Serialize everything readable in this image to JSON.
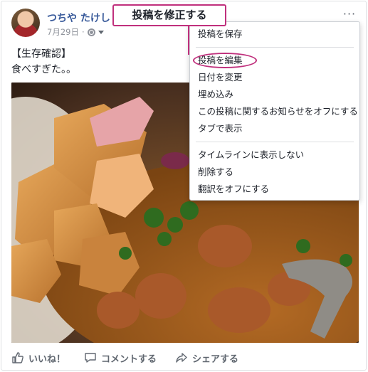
{
  "post": {
    "author": "つちや たけし",
    "date": "7月29日",
    "separator": "·",
    "text_line1": "【生存確認】",
    "text_line2": "食べすぎた。。",
    "photo_alt": "food-photo"
  },
  "actions": {
    "like_label": "いいね！",
    "comment_label": "コメントする",
    "share_label": "シェアする"
  },
  "more_icon": "···",
  "callout": {
    "label": "投稿を修正する",
    "color": "#c0307d"
  },
  "menu": {
    "items_group1": [
      "投稿を保存"
    ],
    "items_group2": [
      "投稿を編集",
      "日付を変更",
      "埋め込み",
      "この投稿に関するお知らせをオフにする",
      "タブで表示"
    ],
    "items_group3": [
      "タイムラインに表示しない",
      "削除する",
      "翻訳をオフにする"
    ]
  },
  "colors": {
    "author": "#365899",
    "muted": "#90949c",
    "action": "#606770",
    "annotation": "#c0307d"
  }
}
